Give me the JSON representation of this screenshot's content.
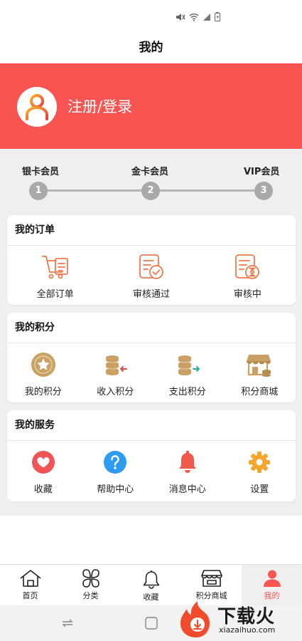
{
  "status_bar": {
    "icons": [
      "mute-icon",
      "wifi-icon",
      "signal-icon",
      "battery-icon"
    ]
  },
  "header": {
    "title": "我的"
  },
  "profile": {
    "login_label": "注册/登录",
    "accent": "#f85552"
  },
  "levels": [
    {
      "label": "银卡会员",
      "num": "1"
    },
    {
      "label": "金卡会员",
      "num": "2"
    },
    {
      "label": "VIP会员",
      "num": "3"
    }
  ],
  "orders": {
    "title": "我的订单",
    "items": [
      {
        "label": "全部订单",
        "icon": "cart-icon"
      },
      {
        "label": "审核通过",
        "icon": "approved-icon"
      },
      {
        "label": "审核中",
        "icon": "pending-icon"
      }
    ]
  },
  "points": {
    "title": "我的积分",
    "items": [
      {
        "label": "我的积分",
        "icon": "star-badge-icon"
      },
      {
        "label": "收入积分",
        "icon": "coins-in-icon"
      },
      {
        "label": "支出积分",
        "icon": "coins-out-icon"
      },
      {
        "label": "积分商城",
        "icon": "store-icon"
      }
    ]
  },
  "services": {
    "title": "我的服务",
    "items": [
      {
        "label": "收藏",
        "icon": "heart-icon"
      },
      {
        "label": "帮助中心",
        "icon": "help-icon"
      },
      {
        "label": "消息中心",
        "icon": "bell-icon"
      },
      {
        "label": "设置",
        "icon": "gear-icon"
      }
    ]
  },
  "tabs": [
    {
      "label": "首页",
      "icon": "home-icon"
    },
    {
      "label": "分类",
      "icon": "category-icon"
    },
    {
      "label": "收藏",
      "icon": "bell-tab-icon"
    },
    {
      "label": "积分商城",
      "icon": "shop-tab-icon"
    },
    {
      "label": "我的",
      "icon": "user-tab-icon"
    }
  ],
  "watermark": {
    "text": "下载火",
    "url": "xiazaihuo.com"
  }
}
